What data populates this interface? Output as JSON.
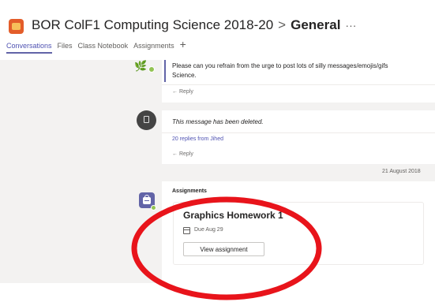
{
  "header": {
    "team_name": "BOR ColF1 Computing Science 2018-20",
    "separator": ">",
    "channel": "General",
    "more": "···"
  },
  "tabs": [
    {
      "label": "Conversations",
      "active": true
    },
    {
      "label": "Files",
      "active": false
    },
    {
      "label": "Class Notebook",
      "active": false
    },
    {
      "label": "Assignments",
      "active": false
    }
  ],
  "tab_add": "+",
  "feed": {
    "post1": {
      "text_line1": "Please can you refrain from the urge to post lots of silly messages/emojis/gifs",
      "text_line2": "Science.",
      "reply": "← Reply"
    },
    "post2": {
      "text": "This message has been deleted.",
      "replies_link": "20 replies from Jihed",
      "reply": "← Reply"
    },
    "date_divider": "21 August 2018",
    "post3": {
      "author": "Assignments",
      "assignment_title": "Graphics Homework 1",
      "due": "Due Aug 29",
      "view_button": "View assignment"
    }
  },
  "colors": {
    "accent": "#6264a7",
    "team_icon": "#e35d2a",
    "annotation": "#e8141b"
  },
  "icons": [
    "team-icon",
    "add-tab-icon",
    "avatar",
    "deleted-icon",
    "assignments-app-icon",
    "calendar-icon"
  ]
}
